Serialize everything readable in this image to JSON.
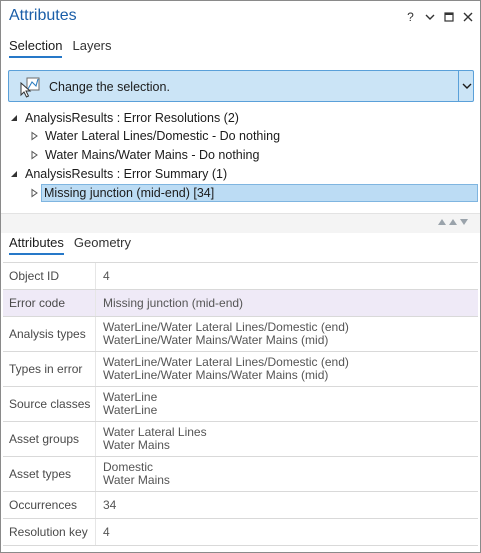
{
  "title": "Attributes",
  "title_tools": {
    "help": "?",
    "menu": "chevron-down",
    "restore": "restore-window",
    "close": "close"
  },
  "top_tabs": [
    {
      "label": "Selection",
      "active": true
    },
    {
      "label": "Layers",
      "active": false
    }
  ],
  "selection_bar": {
    "label": "Change the selection.",
    "icon": "select-cursor-icon"
  },
  "tree": {
    "groups": [
      {
        "label": "AnalysisResults : Error Resolutions (2)",
        "expanded": true,
        "children": [
          {
            "label": "Water Lateral Lines/Domestic - Do nothing"
          },
          {
            "label": "Water Mains/Water Mains - Do nothing"
          }
        ]
      },
      {
        "label": "AnalysisResults : Error Summary (1)",
        "expanded": true,
        "children": [
          {
            "label": "Missing junction (mid-end) [34]",
            "selected": true
          }
        ]
      }
    ]
  },
  "bottom_tabs": [
    {
      "label": "Attributes",
      "active": true
    },
    {
      "label": "Geometry",
      "active": false
    }
  ],
  "attributes": [
    {
      "key": "Object ID",
      "values": [
        "4"
      ]
    },
    {
      "key": "Error code",
      "values": [
        "Missing junction (mid-end)"
      ],
      "highlight": true
    },
    {
      "key": "Analysis types",
      "values": [
        "WaterLine/Water Lateral Lines/Domestic (end)",
        "WaterLine/Water Mains/Water Mains (mid)"
      ]
    },
    {
      "key": "Types in error",
      "values": [
        "WaterLine/Water Lateral Lines/Domestic (end)",
        "WaterLine/Water Mains/Water Mains (mid)"
      ]
    },
    {
      "key": "Source classes",
      "values": [
        "WaterLine",
        "WaterLine"
      ]
    },
    {
      "key": "Asset groups",
      "values": [
        "Water Lateral Lines",
        "Water Mains"
      ]
    },
    {
      "key": "Asset types",
      "values": [
        "Domestic",
        "Water Mains"
      ]
    },
    {
      "key": "Occurrences",
      "values": [
        "34"
      ]
    },
    {
      "key": "Resolution key",
      "values": [
        "4"
      ]
    }
  ],
  "colors": {
    "accent": "#2678c8",
    "title": "#1a5ea8",
    "selection_fill": "#cbe4f6",
    "row_highlight": "#efeaf7"
  }
}
